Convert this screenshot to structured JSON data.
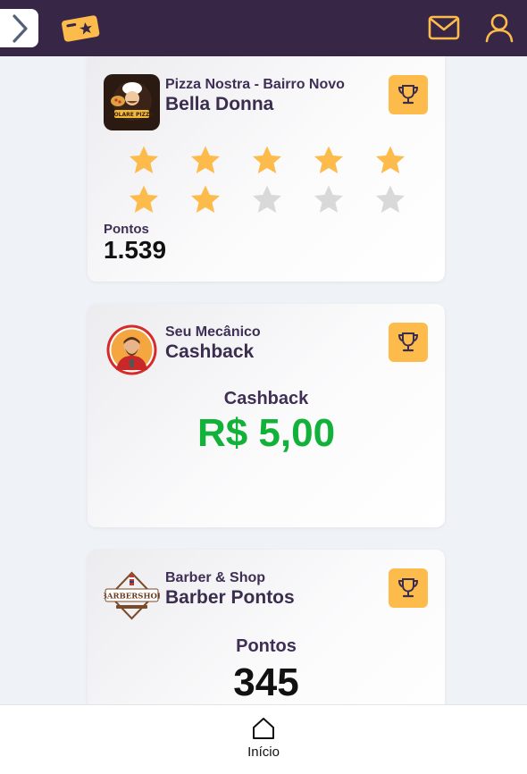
{
  "header": {
    "menu_icon": "chevron-right-icon",
    "logo_icon": "ticket-star-icon",
    "mail_icon": "mail-icon",
    "user_icon": "user-icon",
    "bg_color": "#372645",
    "accent_color": "#fdbb4b"
  },
  "cards": [
    {
      "store": "Pizza Nostra - Bairro Novo",
      "program": "Bella Donna",
      "type": "stars",
      "stars_total": 10,
      "stars_filled": 7,
      "points_label": "Pontos",
      "points_value": "1.539"
    },
    {
      "store": "Seu Mecânico",
      "program": "Cashback",
      "type": "cashback",
      "value_label": "Cashback",
      "value": "R$ 5,00"
    },
    {
      "store": "Barber & Shop",
      "program": "Barber Pontos",
      "type": "points",
      "value_label": "Pontos",
      "value": "345"
    }
  ],
  "logos": {
    "pizza": "VOLARE PIZZA",
    "barber": "BARBERSHOP"
  },
  "bottom_nav": {
    "home_icon": "home-icon",
    "home_label": "Início"
  },
  "colors": {
    "star_filled": "#fdbb4b",
    "star_empty": "#d9d9d9",
    "cashback_green": "#12b23a"
  }
}
